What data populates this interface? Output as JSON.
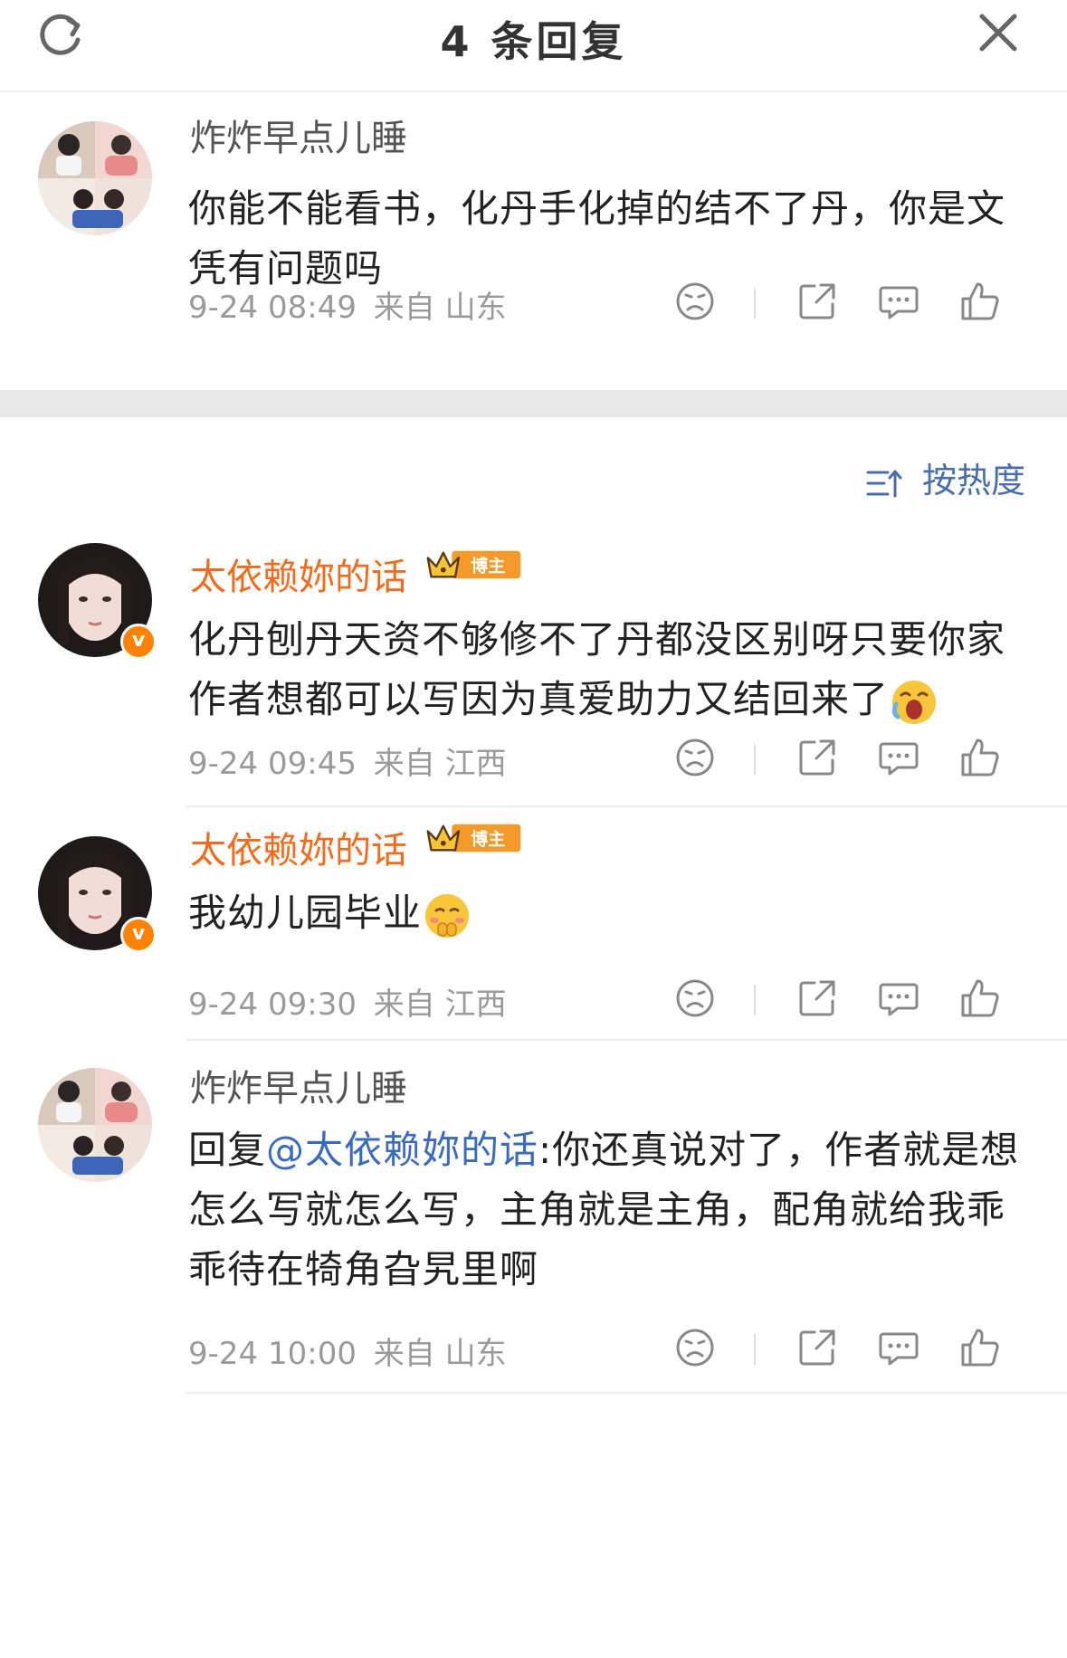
{
  "header": {
    "title": "4 条回复"
  },
  "sort": {
    "label": "按热度"
  },
  "comments": [
    {
      "username": "炸炸早点儿睡",
      "text": "你能不能看书，化丹手化掉的结不了丹，你是文凭有问题吗",
      "time": "9-24 08:49",
      "location": "来自 山东"
    },
    {
      "username": "太依赖妳的话",
      "badge": "博主",
      "text": "化丹刨丹天资不够修不了丹都没区别呀只要你家作者想都可以写因为真爱助力又结回来了",
      "emoji": "crying-face",
      "time": "9-24 09:45",
      "location": "来自 江西"
    },
    {
      "username": "太依赖妳的话",
      "badge": "博主",
      "text": "我幼儿园毕业",
      "emoji": "shy-face",
      "time": "9-24 09:30",
      "location": "来自 江西"
    },
    {
      "username": "炸炸早点儿睡",
      "reply_prefix": "回复",
      "mention": "@太依赖妳的话",
      "text": ":你还真说对了，作者就是想怎么写就怎么写，主角就是主角，配角就给我乖乖待在犄角旮旯里啊",
      "time": "9-24 10:00",
      "location": "来自 山东"
    }
  ],
  "colors": {
    "accent_orange": "#f26b1d",
    "mention_blue": "#3a6bbf",
    "sort_blue": "#4a6ea9"
  }
}
